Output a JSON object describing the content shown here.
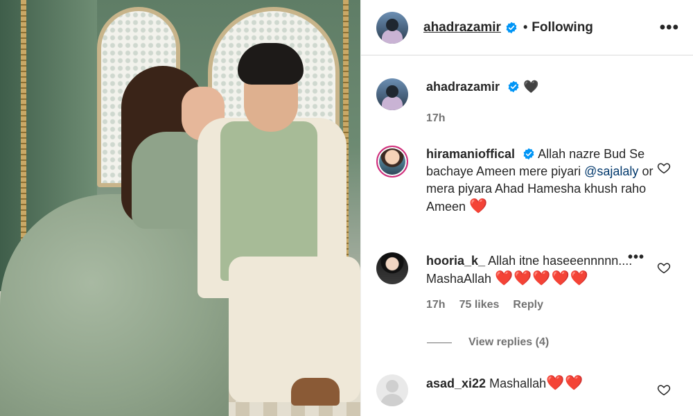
{
  "post": {
    "author": "ahadrazamir",
    "separator": "•",
    "follow_status": "Following",
    "more_label": "•••"
  },
  "caption": {
    "username": "ahadrazamir",
    "text": "🖤",
    "time": "17h"
  },
  "comments": [
    {
      "username": "hiramanioffical",
      "text_before": "Allah nazre Bud Se bachaye Ameen mere piyari ",
      "mention": "@sajalaly",
      "text_after": " or mera piyara Ahad Hamesha khush raho Ameen ",
      "emoji": "❤️"
    },
    {
      "username": "hooria_k_",
      "text": "Allah itne haseeennnnn.... MashaAllah ",
      "emoji": "❤️❤️❤️❤️❤️",
      "time": "17h",
      "likes": "75 likes",
      "reply_label": "Reply",
      "more_label": "•••"
    },
    {
      "username": "asad_xi22",
      "text": "Mashallah",
      "emoji": "❤️❤️"
    }
  ],
  "view_replies": "View replies (4)",
  "colors": {
    "verified": "#0095f6",
    "heart": "#e0142d",
    "mention": "#00376b",
    "muted": "#737373"
  }
}
